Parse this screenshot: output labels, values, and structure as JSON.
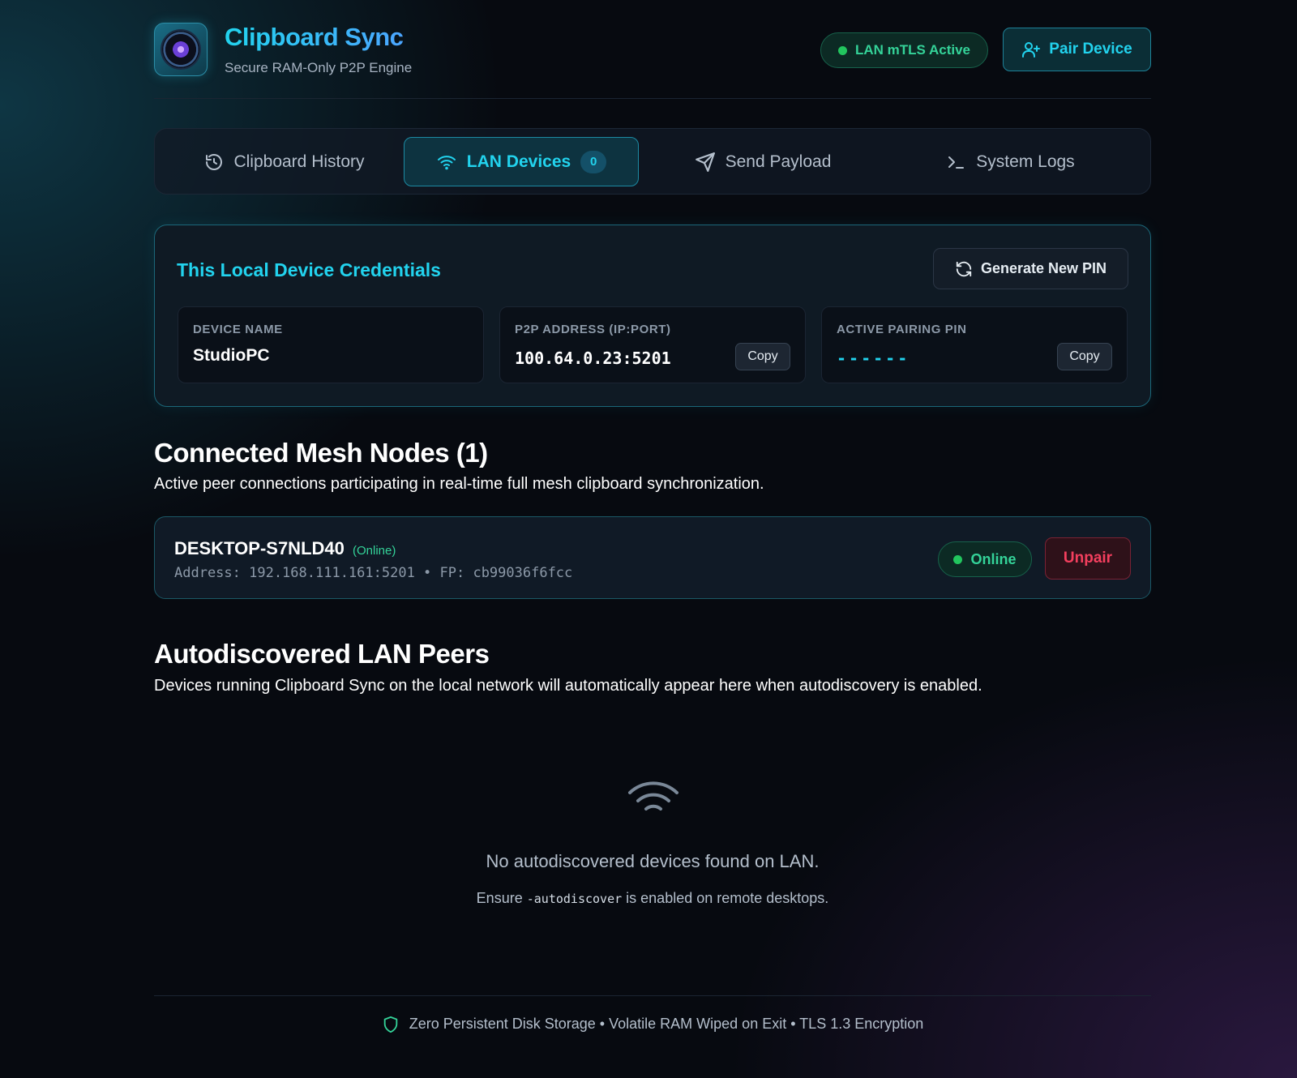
{
  "app": {
    "title": "Clipboard Sync",
    "subtitle": "Secure RAM-Only P2P Engine",
    "status": "LAN mTLS Active",
    "pair_button": "Pair Device"
  },
  "tabs": [
    {
      "label": "Clipboard History",
      "icon": "history-icon",
      "active": false
    },
    {
      "label": "LAN Devices",
      "icon": "wifi-icon",
      "active": true,
      "badge": "0"
    },
    {
      "label": "Send Payload",
      "icon": "send-icon",
      "active": false
    },
    {
      "label": "System Logs",
      "icon": "terminal-icon",
      "active": false
    }
  ],
  "credentials": {
    "title": "This Local Device Credentials",
    "generate_button": "Generate New PIN",
    "fields": [
      {
        "label": "DEVICE NAME",
        "value": "StudioPC"
      },
      {
        "label": "P2P ADDRESS (IP:PORT)",
        "value": "100.64.0.23:5201",
        "copy": "Copy"
      },
      {
        "label": "ACTIVE PAIRING PIN",
        "value": "------",
        "copy": "Copy"
      }
    ]
  },
  "mesh": {
    "title": "Connected Mesh Nodes (1)",
    "description": "Active peer connections participating in real-time full mesh clipboard synchronization.",
    "nodes": [
      {
        "name": "DESKTOP-S7NLD40",
        "status_inline": "(Online)",
        "meta": "Address: 192.168.111.161:5201 • FP: cb99036f6fcc",
        "status": "Online",
        "action": "Unpair"
      }
    ]
  },
  "discovered": {
    "title": "Autodiscovered LAN Peers",
    "description": "Devices running Clipboard Sync on the local network will automatically appear here when autodiscovery is enabled.",
    "empty_title": "No autodiscovered devices found on LAN.",
    "hint_before": "Ensure",
    "hint_code": "-autodiscover",
    "hint_after": "is enabled on remote desktops."
  },
  "footer": {
    "text": "Zero Persistent Disk Storage • Volatile RAM Wiped on Exit • TLS 1.3 Encryption"
  },
  "colors": {
    "accent": "#22d3ee",
    "success": "#34d399",
    "danger": "#f43f5e",
    "background": "#070a10"
  }
}
